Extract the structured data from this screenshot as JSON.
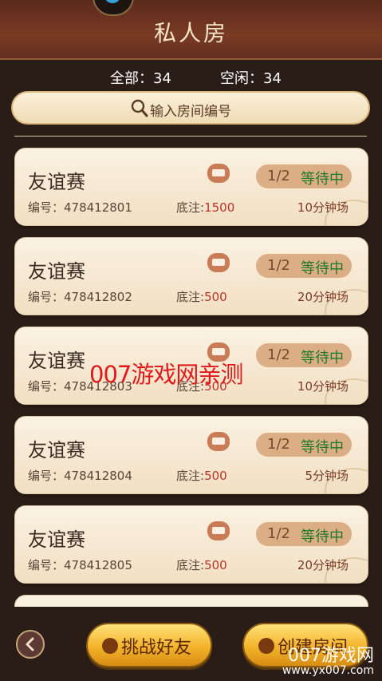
{
  "header": {
    "title": "私人房"
  },
  "stats": {
    "all": "全部：34",
    "idle": "空闲：34"
  },
  "search": {
    "placeholder": "输入房间编号"
  },
  "rooms": [
    {
      "name": "友谊赛",
      "seats": "1/2",
      "state": "等待中",
      "code": "编号：478412801",
      "stake_label": "底注:",
      "stake": "1500",
      "duration": "10分钟场"
    },
    {
      "name": "友谊赛",
      "seats": "1/2",
      "state": "等待中",
      "code": "编号：478412802",
      "stake_label": "底注:",
      "stake": "500",
      "duration": "20分钟场"
    },
    {
      "name": "友谊赛",
      "seats": "1/2",
      "state": "等待中",
      "code": "编号：478412803",
      "stake_label": "底注:",
      "stake": "500",
      "duration": "10分钟场"
    },
    {
      "name": "友谊赛",
      "seats": "1/2",
      "state": "等待中",
      "code": "编号：478412804",
      "stake_label": "底注:",
      "stake": "500",
      "duration": "5分钟场"
    },
    {
      "name": "友谊赛",
      "seats": "1/2",
      "state": "等待中",
      "code": "编号：478412805",
      "stake_label": "底注:",
      "stake": "500",
      "duration": "20分钟场"
    }
  ],
  "watermark": "007游戏网亲测",
  "buttons": {
    "challenge": "挑战好友",
    "create": "创建房间"
  },
  "corner_mark": {
    "brand": "007游戏网",
    "url": "www.yx007.com"
  },
  "colors": {
    "waiting": "#1d7a28",
    "stake": "#b83328"
  }
}
